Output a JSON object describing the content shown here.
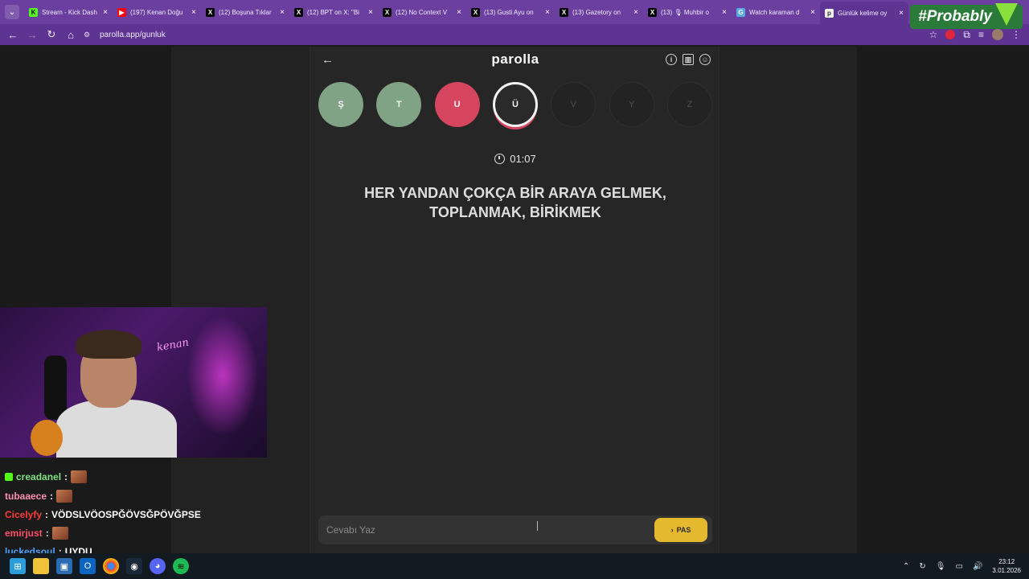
{
  "browser": {
    "tabs": [
      {
        "title": "Stream - Kick Dash",
        "favicon": "kick-icon"
      },
      {
        "title": "(197) Kenan Doğu",
        "favicon": "youtube-icon"
      },
      {
        "title": "(12) Boşuna Tıklar",
        "favicon": "x-icon"
      },
      {
        "title": "(12) BPT on X: \"Bi",
        "favicon": "x-icon"
      },
      {
        "title": "(12) No Context V",
        "favicon": "x-icon"
      },
      {
        "title": "(13) Gusti Ayu on",
        "favicon": "x-icon"
      },
      {
        "title": "(13) Gazetory on",
        "favicon": "x-icon"
      },
      {
        "title": "(13) 🎙 Muhbir o",
        "favicon": "x-icon"
      },
      {
        "title": "Watch karaman d",
        "favicon": "go-icon"
      },
      {
        "title": "Günlük kelime oy",
        "favicon": "parolla-icon",
        "active": true
      }
    ],
    "url": "parolla.app/gunluk",
    "overlay_tag": "#Probably"
  },
  "app": {
    "logo": "parolla",
    "letters": [
      {
        "char": "Ş",
        "state": "correct"
      },
      {
        "char": "T",
        "state": "correct"
      },
      {
        "char": "U",
        "state": "wrong"
      },
      {
        "char": "Ü",
        "state": "current"
      },
      {
        "char": "V",
        "state": "pending"
      },
      {
        "char": "Y",
        "state": "pending"
      },
      {
        "char": "Z",
        "state": "pending"
      }
    ],
    "timer": "01:07",
    "question": "HER YANDAN ÇOKÇA BİR ARAYA GELMEK, TOPLANMAK, BİRİKMEK",
    "answer_placeholder": "Cevabı Yaz",
    "pass_label": "PAS",
    "colors": {
      "correct": "#7fa384",
      "wrong": "#d6455e",
      "pass": "#e5b92d"
    }
  },
  "stream": {
    "webcam_neon": "kenan",
    "chat": [
      {
        "user": "creadanel",
        "color": "#7fe07f",
        "msg": "",
        "emote": true,
        "badge": true
      },
      {
        "user": "tubaaece",
        "color": "#ff8fb0",
        "msg": "",
        "emote": true
      },
      {
        "user": "Cicelyfy",
        "color": "#ff3b3b",
        "msg": "VÖDSLVÖOSPĞÖVSĞPÖVĞPSE"
      },
      {
        "user": "emirjust",
        "color": "#ff4f6a",
        "msg": "",
        "emote": true
      },
      {
        "user": "luckedsoul",
        "color": "#4aa3ff",
        "msg": "UYDU"
      }
    ]
  },
  "taskbar": {
    "time": "23:12",
    "date": "3.01.2026"
  }
}
